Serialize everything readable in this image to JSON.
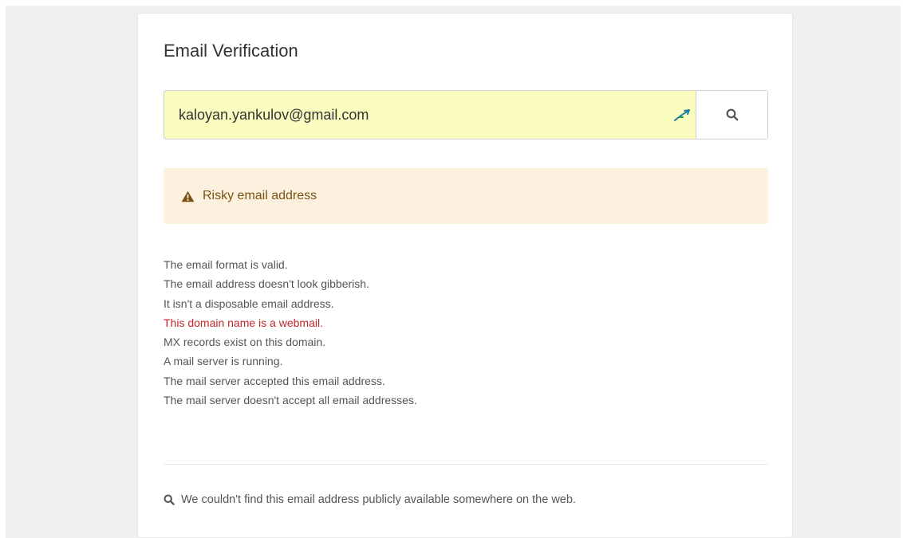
{
  "page": {
    "title": "Email Verification"
  },
  "search": {
    "email_value": "kaloyan.yankulov@gmail.com",
    "button_icon": "search-icon",
    "autofill_icon": "autofill-arrow-icon"
  },
  "alert": {
    "icon": "warning-triangle-icon",
    "text": "Risky email address",
    "color": "#7a5312",
    "background": "#fcf0de"
  },
  "checks": [
    {
      "text": "The email format is valid.",
      "status": "ok"
    },
    {
      "text": "The email address doesn't look gibberish.",
      "status": "ok"
    },
    {
      "text": "It isn't a disposable email address.",
      "status": "ok"
    },
    {
      "text": "This domain name is a webmail.",
      "status": "warning"
    },
    {
      "text": "MX records exist on this domain.",
      "status": "ok"
    },
    {
      "text": "A mail server is running.",
      "status": "ok"
    },
    {
      "text": "The mail server accepted this email address.",
      "status": "ok"
    },
    {
      "text": "The mail server doesn't accept all email addresses.",
      "status": "ok"
    }
  ],
  "web_search": {
    "icon": "search-icon",
    "text": "We couldn't find this email address publicly available somewhere on the web."
  },
  "colors": {
    "input_background": "#fbfcc0",
    "warning_text": "#c0282d"
  }
}
